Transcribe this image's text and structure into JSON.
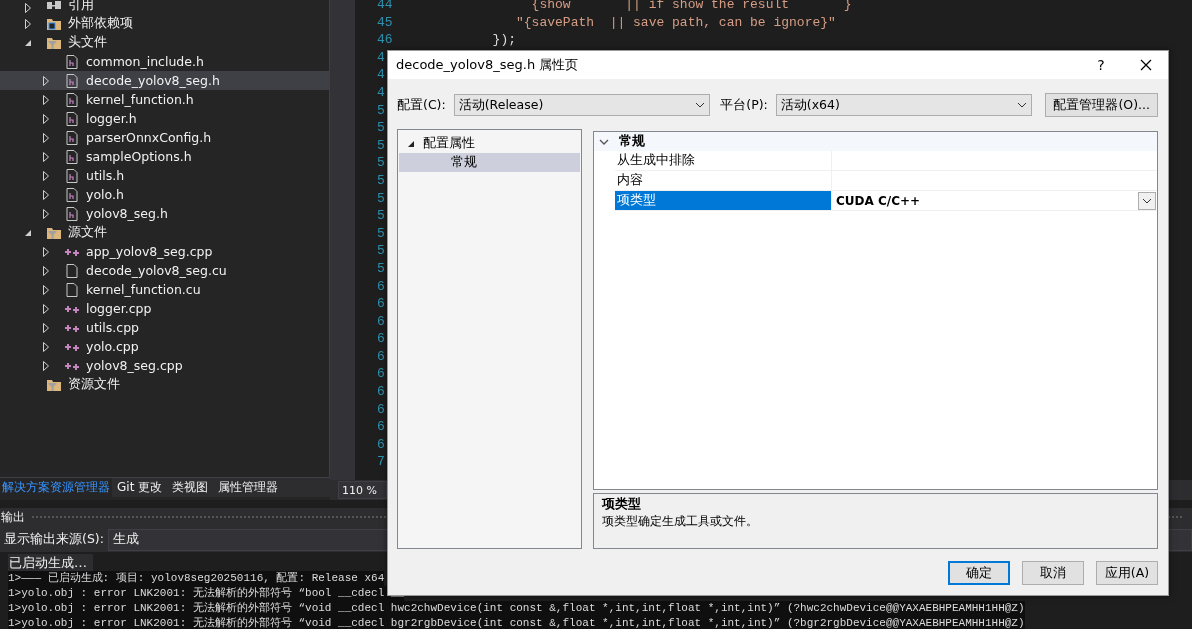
{
  "explorer": {
    "items": [
      {
        "label": "引用",
        "kind": "references",
        "expanded": false,
        "selected": false
      },
      {
        "label": "外部依赖项",
        "kind": "external",
        "expanded": false,
        "selected": false
      },
      {
        "label": "头文件",
        "kind": "filter",
        "expanded": true,
        "selected": false,
        "children": [
          {
            "label": "common_include.h",
            "kind": "header",
            "selected": false
          },
          {
            "label": "decode_yolov8_seg.h",
            "kind": "header",
            "expanded": false,
            "selected": true
          },
          {
            "label": "kernel_function.h",
            "kind": "header",
            "expanded": false,
            "selected": false
          },
          {
            "label": "logger.h",
            "kind": "header",
            "expanded": false,
            "selected": false
          },
          {
            "label": "parserOnnxConfig.h",
            "kind": "header",
            "expanded": false,
            "selected": false
          },
          {
            "label": "sampleOptions.h",
            "kind": "header",
            "expanded": false,
            "selected": false
          },
          {
            "label": "utils.h",
            "kind": "header",
            "expanded": false,
            "selected": false
          },
          {
            "label": "yolo.h",
            "kind": "header",
            "expanded": false,
            "selected": false
          },
          {
            "label": "yolov8_seg.h",
            "kind": "header",
            "expanded": false,
            "selected": false
          }
        ]
      },
      {
        "label": "源文件",
        "kind": "filter",
        "expanded": true,
        "selected": false,
        "children": [
          {
            "label": "app_yolov8_seg.cpp",
            "kind": "cpp",
            "expanded": false,
            "selected": false
          },
          {
            "label": "decode_yolov8_seg.cu",
            "kind": "file",
            "expanded": false,
            "selected": false
          },
          {
            "label": "kernel_function.cu",
            "kind": "file",
            "expanded": false,
            "selected": false
          },
          {
            "label": "logger.cpp",
            "kind": "cpp",
            "expanded": false,
            "selected": false
          },
          {
            "label": "utils.cpp",
            "kind": "cpp",
            "expanded": false,
            "selected": false
          },
          {
            "label": "yolo.cpp",
            "kind": "cpp",
            "expanded": false,
            "selected": false
          },
          {
            "label": "yolov8_seg.cpp",
            "kind": "cpp",
            "expanded": false,
            "selected": false
          }
        ]
      },
      {
        "label": "资源文件",
        "kind": "filter",
        "selected": false
      }
    ],
    "tabs": [
      {
        "label": "解决方案资源管理器",
        "selected": true
      },
      {
        "label": "Git 更改",
        "selected": false
      },
      {
        "label": "类视图",
        "selected": false
      },
      {
        "label": "属性管理器",
        "selected": false
      }
    ]
  },
  "editor": {
    "line_numbers": [
      "44",
      "45",
      "46",
      "4",
      "4",
      "4",
      "5",
      "5",
      "5",
      "5",
      "5",
      "5",
      "5",
      "5",
      "5",
      "5",
      "6",
      "6",
      "6",
      "6",
      "6",
      "6",
      "6",
      "6",
      "6",
      "6",
      "7"
    ],
    "code_lines": [
      {
        "text": "                 {show       || if show the result       }",
        "kind": "string"
      },
      {
        "text": "               \"{savePath  || save path, can be ignore}\"",
        "kind": "string"
      },
      {
        "text": "            });",
        "kind": "plain"
      }
    ],
    "zoom": "110 %"
  },
  "output": {
    "title": "输出",
    "source_label": "显示输出来源(S):",
    "source": "生成",
    "status": "已启动生成…",
    "lines": [
      "1>——— 已启动生成: 项目: yolov8seg20250116, 配置: Release x64",
      "1>yolo.obj : error LNK2001: 无法解析的外部符号 “bool __cdecl __",
      "1>yolo.obj : error LNK2001: 无法解析的外部符号 “void __cdecl hwc2chwDevice(int const &,float *,int,int,float *,int,int)” (?hwc2chwDevice@@YAXAEBHPEAMHH1HH@Z)",
      "1>yolo.obj : error LNK2001: 无法解析的外部符号 “void __cdecl bgr2rgbDevice(int const &,float *,int,int,float *,int,int)” (?bgr2rgbDevice@@YAXAEBHPEAMHH1HH@Z)"
    ]
  },
  "dialog": {
    "title": "decode_yolov8_seg.h 属性页",
    "help": "?",
    "config_label": "配置(C):",
    "config": "活动(Release)",
    "platform_label": "平台(P):",
    "platform": "活动(x64)",
    "manager_button": "配置管理器(O)...",
    "nav": [
      {
        "label": "配置属性",
        "expanded": true,
        "selected": false,
        "children": [
          {
            "label": "常规",
            "selected": true
          }
        ]
      }
    ],
    "grid": {
      "category": "常规",
      "expanded": true,
      "rows": [
        {
          "name": "从生成中排除",
          "selected": false
        },
        {
          "name": "内容",
          "selected": false
        },
        {
          "name": "项类型",
          "value": "CUDA C/C++",
          "selected": true
        }
      ]
    },
    "description": {
      "title": "项类型",
      "text": "项类型确定生成工具或文件。"
    },
    "buttons": [
      {
        "label": "确定",
        "default": true
      },
      {
        "label": "取消",
        "default": false
      },
      {
        "label": "应用(A)",
        "default": false
      }
    ]
  }
}
